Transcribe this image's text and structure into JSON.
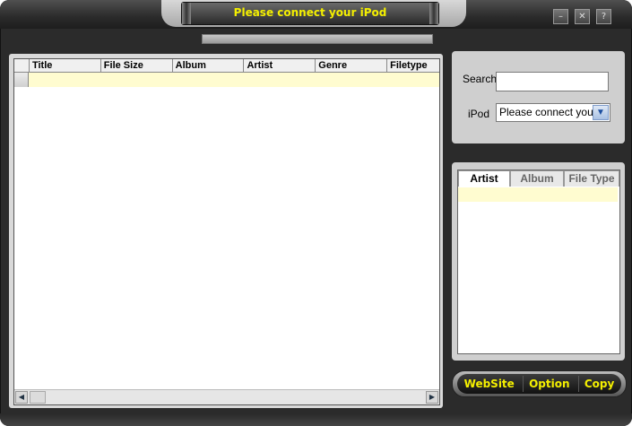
{
  "title": "Please connect your iPod",
  "progress": {
    "fraction": 0
  },
  "window_buttons": [
    "–",
    "✕",
    "?"
  ],
  "table": {
    "columns": [
      "Title",
      "File Size",
      "Album",
      "Artist",
      "Genre",
      "Filetype"
    ]
  },
  "search": {
    "label": "Search",
    "value": ""
  },
  "ipod": {
    "label": "iPod",
    "value": "Please connect your iPod"
  },
  "filter_tabs": [
    "Artist",
    "Album",
    "File Type"
  ],
  "actions": {
    "website": "WebSite",
    "option": "Option",
    "copy": "Copy"
  },
  "colors": {
    "title_text": "#f5f000",
    "row_highlight": "#fffcd0"
  }
}
